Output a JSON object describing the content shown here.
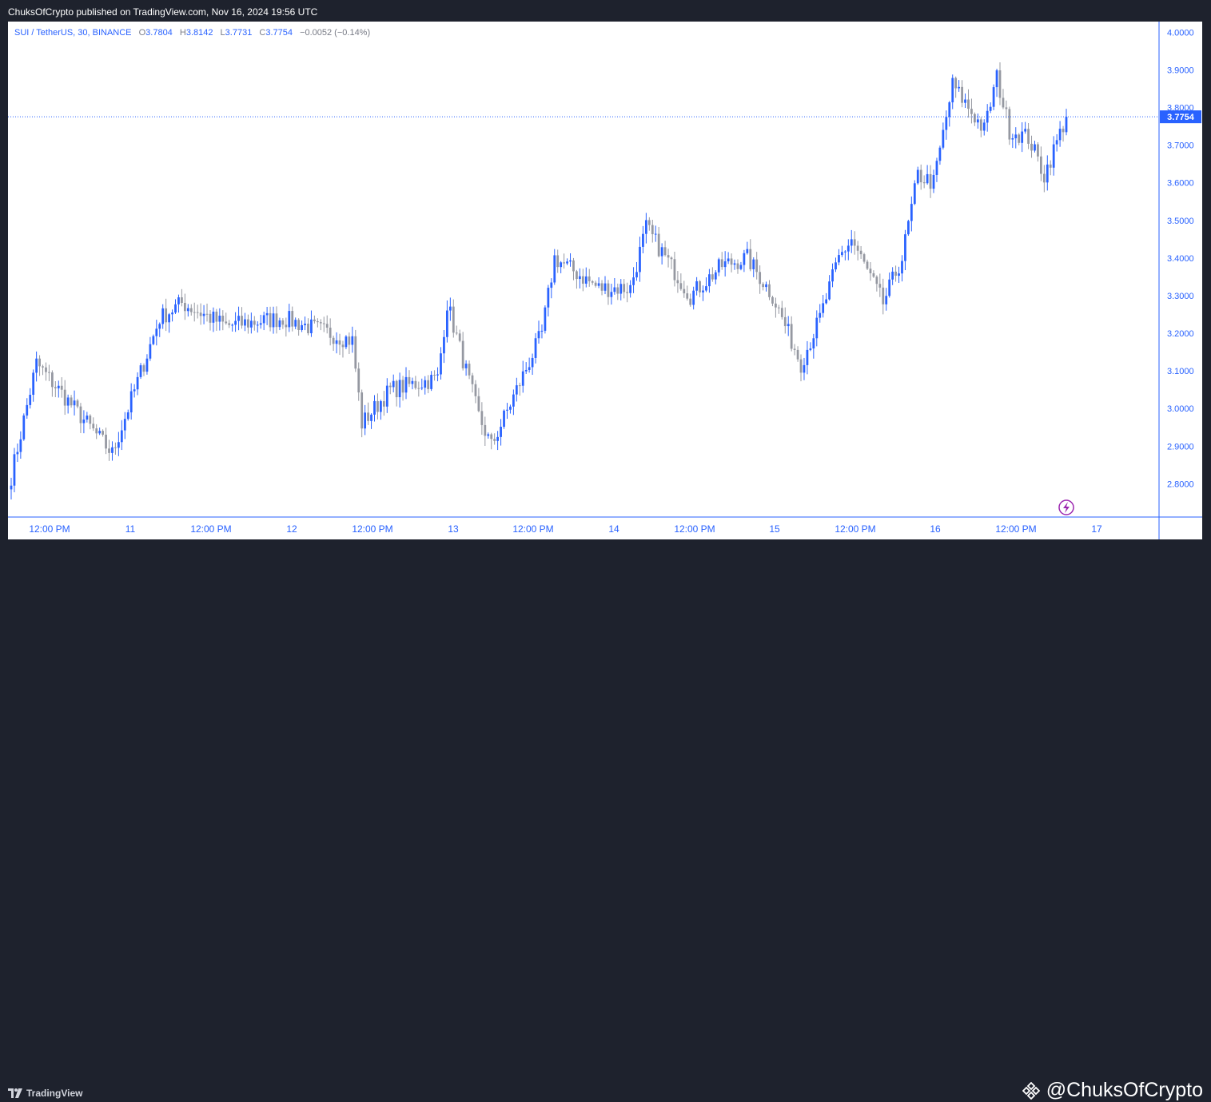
{
  "header": {
    "published_text": "ChuksOfCrypto published on TradingView.com, Nov 16, 2024 19:56 UTC"
  },
  "legend": {
    "symbol": "SUI / TetherUS, 30, BINANCE",
    "open_label": "O",
    "open": "3.7804",
    "high_label": "H",
    "high": "3.8142",
    "low_label": "L",
    "low": "3.7731",
    "close_label": "C",
    "close": "3.7754",
    "change": "−0.0052 (−0.14%)"
  },
  "footer": {
    "brand": "TradingView",
    "watermark": "@ChuksOfCrypto"
  },
  "colors": {
    "up": "#2962ff",
    "down": "#9598a1",
    "axis_text": "#2962ff",
    "price_line": "#2962ff",
    "lightning": "#9c27b0"
  },
  "icons": [
    "tradingview-logo-icon",
    "lightning-icon",
    "binance-diamond-icon"
  ],
  "chart_data": {
    "type": "candlestick",
    "timeframe": "30",
    "ylim": [
      2.72,
      4.02
    ],
    "y_ticks": [
      "4.0000",
      "3.9000",
      "3.8000",
      "3.7000",
      "3.6000",
      "3.5000",
      "3.4000",
      "3.3000",
      "3.2000",
      "3.1000",
      "3.0000",
      "2.9000",
      "2.8000"
    ],
    "x_ticks": [
      "12:00 PM",
      "11",
      "12:00 PM",
      "12",
      "12:00 PM",
      "13",
      "12:00 PM",
      "14",
      "12:00 PM",
      "15",
      "12:00 PM",
      "16",
      "12:00 PM",
      "17"
    ],
    "last_price": "3.7754",
    "key_points": [
      {
        "i": 0,
        "price": 2.82
      },
      {
        "i": 8,
        "price": 3.12
      },
      {
        "i": 32,
        "price": 2.88
      },
      {
        "i": 47,
        "price": 3.24
      },
      {
        "i": 54,
        "price": 3.28
      },
      {
        "i": 68,
        "price": 3.22
      },
      {
        "i": 86,
        "price": 3.24
      },
      {
        "i": 108,
        "price": 3.18
      },
      {
        "i": 111,
        "price": 2.96
      },
      {
        "i": 120,
        "price": 3.05
      },
      {
        "i": 135,
        "price": 3.08
      },
      {
        "i": 138,
        "price": 3.28
      },
      {
        "i": 148,
        "price": 2.98
      },
      {
        "i": 152,
        "price": 2.9
      },
      {
        "i": 168,
        "price": 3.2
      },
      {
        "i": 172,
        "price": 3.4
      },
      {
        "i": 186,
        "price": 3.32
      },
      {
        "i": 196,
        "price": 3.32
      },
      {
        "i": 201,
        "price": 3.48
      },
      {
        "i": 215,
        "price": 3.3
      },
      {
        "i": 225,
        "price": 3.38
      },
      {
        "i": 233,
        "price": 3.4
      },
      {
        "i": 241,
        "price": 3.3
      },
      {
        "i": 250,
        "price": 3.12
      },
      {
        "i": 256,
        "price": 3.24
      },
      {
        "i": 262,
        "price": 3.4
      },
      {
        "i": 266,
        "price": 3.45
      },
      {
        "i": 276,
        "price": 3.28
      },
      {
        "i": 282,
        "price": 3.4
      },
      {
        "i": 287,
        "price": 3.62
      },
      {
        "i": 292,
        "price": 3.6
      },
      {
        "i": 298,
        "price": 3.86
      },
      {
        "i": 308,
        "price": 3.74
      },
      {
        "i": 312,
        "price": 3.88
      },
      {
        "i": 316,
        "price": 3.74
      },
      {
        "i": 322,
        "price": 3.72
      },
      {
        "i": 327,
        "price": 3.62
      },
      {
        "i": 334,
        "price": 3.7754
      }
    ]
  }
}
